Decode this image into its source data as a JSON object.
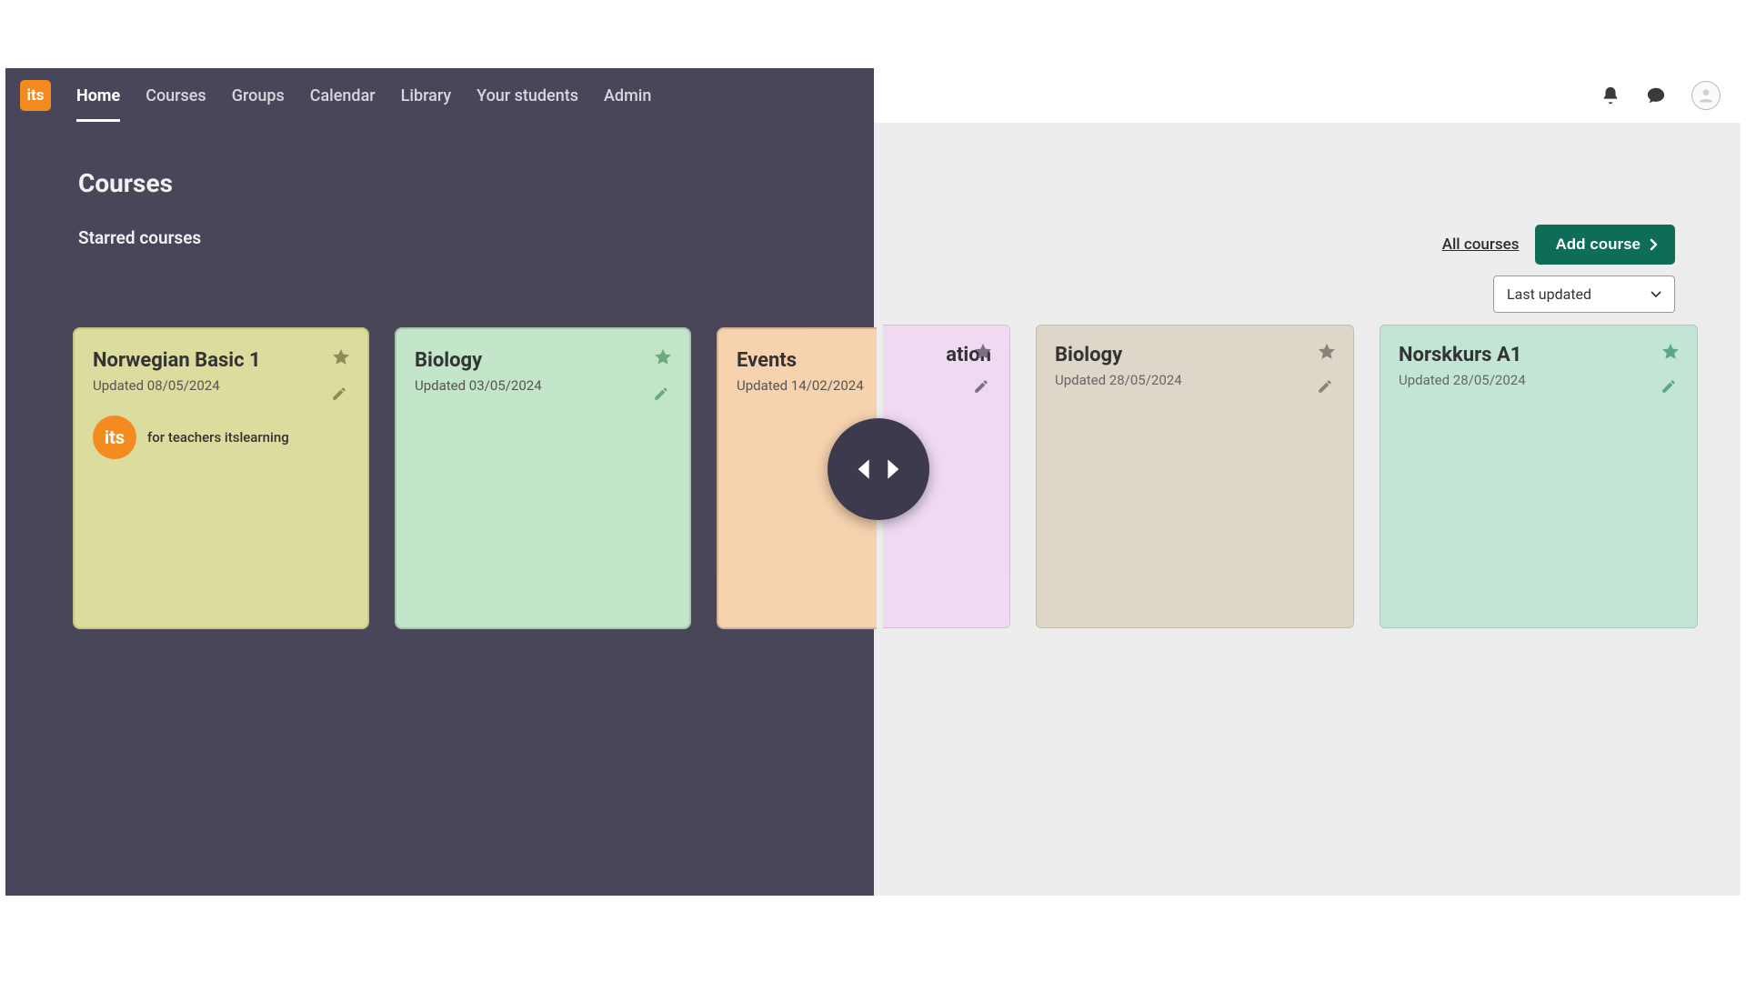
{
  "nav": {
    "items": [
      "Home",
      "Courses",
      "Groups",
      "Calendar",
      "Library",
      "Your students",
      "Admin"
    ],
    "active_index": 0,
    "logo_text": "its"
  },
  "page": {
    "title": "Courses",
    "subsection": "Starred courses"
  },
  "toolbar": {
    "all_courses_label": "All courses",
    "add_course_label": "Add course",
    "sort_selected": "Last updated"
  },
  "left_cards": [
    {
      "title": "Norwegian Basic 1",
      "updated": "Updated 08/05/2024",
      "color": "c-olive",
      "teacher": {
        "avatar_text": "its",
        "name": "for teachers itslearning"
      }
    },
    {
      "title": "Biology",
      "updated": "Updated 03/05/2024",
      "color": "c-green"
    },
    {
      "title": "Events",
      "updated": "Updated 14/02/2024",
      "color": "c-peach",
      "clipped": true
    }
  ],
  "right_cards": [
    {
      "title_fragment": "ation",
      "color": "c-purple",
      "truncated": true
    },
    {
      "title": "Biology",
      "updated": "Updated 28/05/2024",
      "color": "c-tan"
    },
    {
      "title": "Norskkurs A1",
      "updated": "Updated 28/05/2024",
      "color": "c-mint"
    }
  ],
  "header_icons": [
    "bell",
    "chat",
    "avatar"
  ]
}
